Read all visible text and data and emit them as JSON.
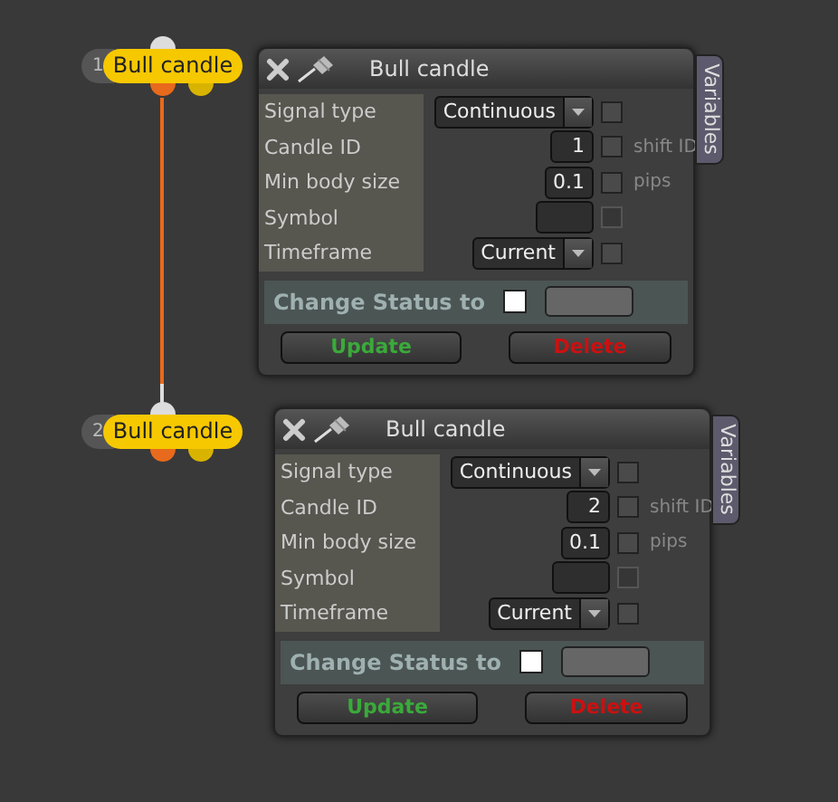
{
  "nodes": [
    {
      "number": "1",
      "label": "Bull candle",
      "panel": {
        "title": "Bull candle",
        "side_tab": "Variables",
        "fields": [
          {
            "kind": "select",
            "label": "Signal type",
            "value": "Continuous",
            "checked": false,
            "disabled": false
          },
          {
            "kind": "input",
            "label": "Candle ID",
            "value": "1",
            "checked": false,
            "disabled": false,
            "note": "shift ID"
          },
          {
            "kind": "input",
            "label": "Min body size",
            "value": "0.1",
            "checked": false,
            "disabled": false,
            "note": "pips"
          },
          {
            "kind": "input",
            "label": "Symbol",
            "checked": false,
            "disabled": true
          },
          {
            "kind": "select",
            "label": "Timeframe",
            "value": "Current",
            "checked": false,
            "disabled": false
          }
        ],
        "status": {
          "label": "Change Status to",
          "checked": false
        },
        "buttons": [
          {
            "kind": "update",
            "label": "Update"
          },
          {
            "kind": "delete",
            "label": "Delete"
          }
        ]
      }
    },
    {
      "number": "2",
      "label": "Bull candle",
      "panel": {
        "title": "Bull candle",
        "side_tab": "Variables",
        "fields": [
          {
            "kind": "select",
            "label": "Signal type",
            "value": "Continuous",
            "checked": false,
            "disabled": false
          },
          {
            "kind": "input",
            "label": "Candle ID",
            "value": "2",
            "checked": false,
            "disabled": false,
            "note": "shift ID"
          },
          {
            "kind": "input",
            "label": "Min body size",
            "value": "0.1",
            "checked": false,
            "disabled": false,
            "note": "pips"
          },
          {
            "kind": "input",
            "label": "Symbol",
            "checked": false,
            "disabled": true
          },
          {
            "kind": "select",
            "label": "Timeframe",
            "value": "Current",
            "checked": false,
            "disabled": false
          }
        ],
        "status": {
          "label": "Change Status to",
          "checked": false
        },
        "buttons": [
          {
            "kind": "update",
            "label": "Update"
          },
          {
            "kind": "delete",
            "label": "Delete"
          }
        ]
      }
    }
  ]
}
